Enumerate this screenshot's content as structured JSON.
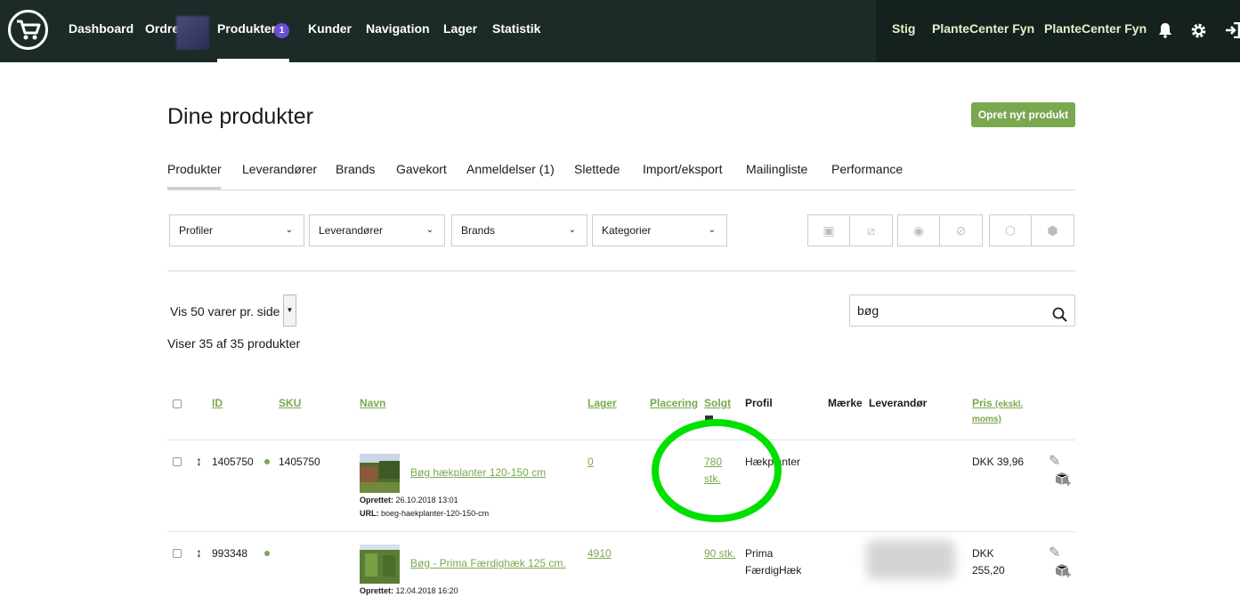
{
  "topnav": {
    "items": [
      "Dashboard",
      "Ordre",
      "Produkter",
      "Kunder",
      "Navigation",
      "Lager",
      "Statistik"
    ],
    "products_badge": "1",
    "right": [
      "Stig",
      "PlanteCenter Fyn",
      "PlanteCenter Fyn"
    ],
    "icons": [
      "bell-icon",
      "gear-icon",
      "logout-icon"
    ]
  },
  "header": {
    "title": "Dine produkter",
    "create_button": "Opret nyt produkt"
  },
  "subtabs": [
    "Produkter",
    "Leverandører",
    "Brands",
    "Gavekort",
    "Anmeldelser (1)",
    "Slettede",
    "Import/eksport",
    "Mailingliste",
    "Performance"
  ],
  "filters": [
    "Profiler",
    "Leverandører",
    "Brands",
    "Kategorier"
  ],
  "paging": {
    "per_page_label": "Vis 50 varer pr. side",
    "count_label": "Viser 35 af 35 produkter"
  },
  "search": {
    "value": "bøg"
  },
  "table": {
    "headers": {
      "id": "ID",
      "sku": "SKU",
      "name": "Navn",
      "stock": "Lager",
      "placement": "Placering",
      "sold": "Solgt",
      "profile": "Profil",
      "brand": "Mærke",
      "supplier": "Leverandør",
      "price": "Pris",
      "price_sub": "(ekskl.",
      "price_sub2": "moms)"
    },
    "rows": [
      {
        "id": "1405750",
        "sku": "1405750",
        "name": "Bøg hækplanter 120-150 cm",
        "created_label": "Oprettet:",
        "created": "26.10.2018 13:01",
        "url_label": "URL:",
        "url": "boeg-haekplanter-120-150-cm",
        "stock": "0",
        "sold_line1": "780",
        "sold_line2": "stk.",
        "profile_line1": "Hækplanter",
        "profile_line2": "",
        "price_line1": "DKK 39,96",
        "price_line2": ""
      },
      {
        "id": "993348",
        "sku": "",
        "name": "Bøg - Prima Færdighæk 125 cm.",
        "created_label": "Oprettet:",
        "created": "12.04.2018 16:20",
        "stock": "4910",
        "sold_line1": "90 stk.",
        "profile_line1": "Prima",
        "profile_line2": "FærdigHæk",
        "price_line1": "DKK",
        "price_line2": "255,20"
      }
    ]
  }
}
